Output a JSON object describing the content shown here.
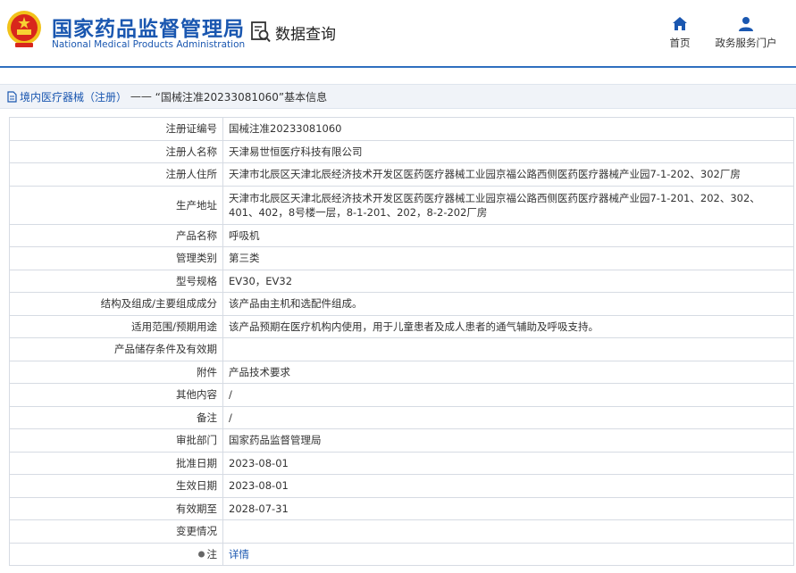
{
  "header": {
    "site_name_cn": "国家药品监督管理局",
    "site_name_en": "National Medical Products Administration",
    "query_label": "数据查询",
    "nav": [
      {
        "label": "首页",
        "icon": "home-icon"
      },
      {
        "label": "政务服务门户",
        "icon": "user-icon"
      }
    ]
  },
  "breadcrumb": {
    "section": "境内医疗器械（注册）",
    "separator": "——",
    "title": "“国械注准20233081060”基本信息"
  },
  "record": {
    "rows": [
      {
        "label": "注册证编号",
        "value": "国械注准20233081060"
      },
      {
        "label": "注册人名称",
        "value": "天津易世恒医疗科技有限公司"
      },
      {
        "label": "注册人住所",
        "value": "天津市北辰区天津北辰经济技术开发区医药医疗器械工业园京福公路西侧医药医疗器械产业园7-1-202、302厂房"
      },
      {
        "label": "生产地址",
        "value": "天津市北辰区天津北辰经济技术开发区医药医疗器械工业园京福公路西侧医药医疗器械产业园7-1-201、202、302、401、402，8号楼一层，8-1-201、202，8-2-202厂房"
      },
      {
        "label": "产品名称",
        "value": "呼吸机"
      },
      {
        "label": "管理类别",
        "value": "第三类"
      },
      {
        "label": "型号规格",
        "value": "EV30，EV32"
      },
      {
        "label": "结构及组成/主要组成成分",
        "value": "该产品由主机和选配件组成。"
      },
      {
        "label": "适用范围/预期用途",
        "value": "该产品预期在医疗机构内使用，用于儿童患者及成人患者的通气辅助及呼吸支持。"
      },
      {
        "label": "产品储存条件及有效期",
        "value": ""
      },
      {
        "label": "附件",
        "value": "产品技术要求"
      },
      {
        "label": "其他内容",
        "value": "/"
      },
      {
        "label": "备注",
        "value": "/"
      },
      {
        "label": "审批部门",
        "value": "国家药品监督管理局"
      },
      {
        "label": "批准日期",
        "value": "2023-08-01"
      },
      {
        "label": "生效日期",
        "value": "2023-08-01"
      },
      {
        "label": "有效期至",
        "value": "2028-07-31"
      },
      {
        "label": "变更情况",
        "value": ""
      }
    ],
    "note_label": "注",
    "note_link": "详情"
  }
}
